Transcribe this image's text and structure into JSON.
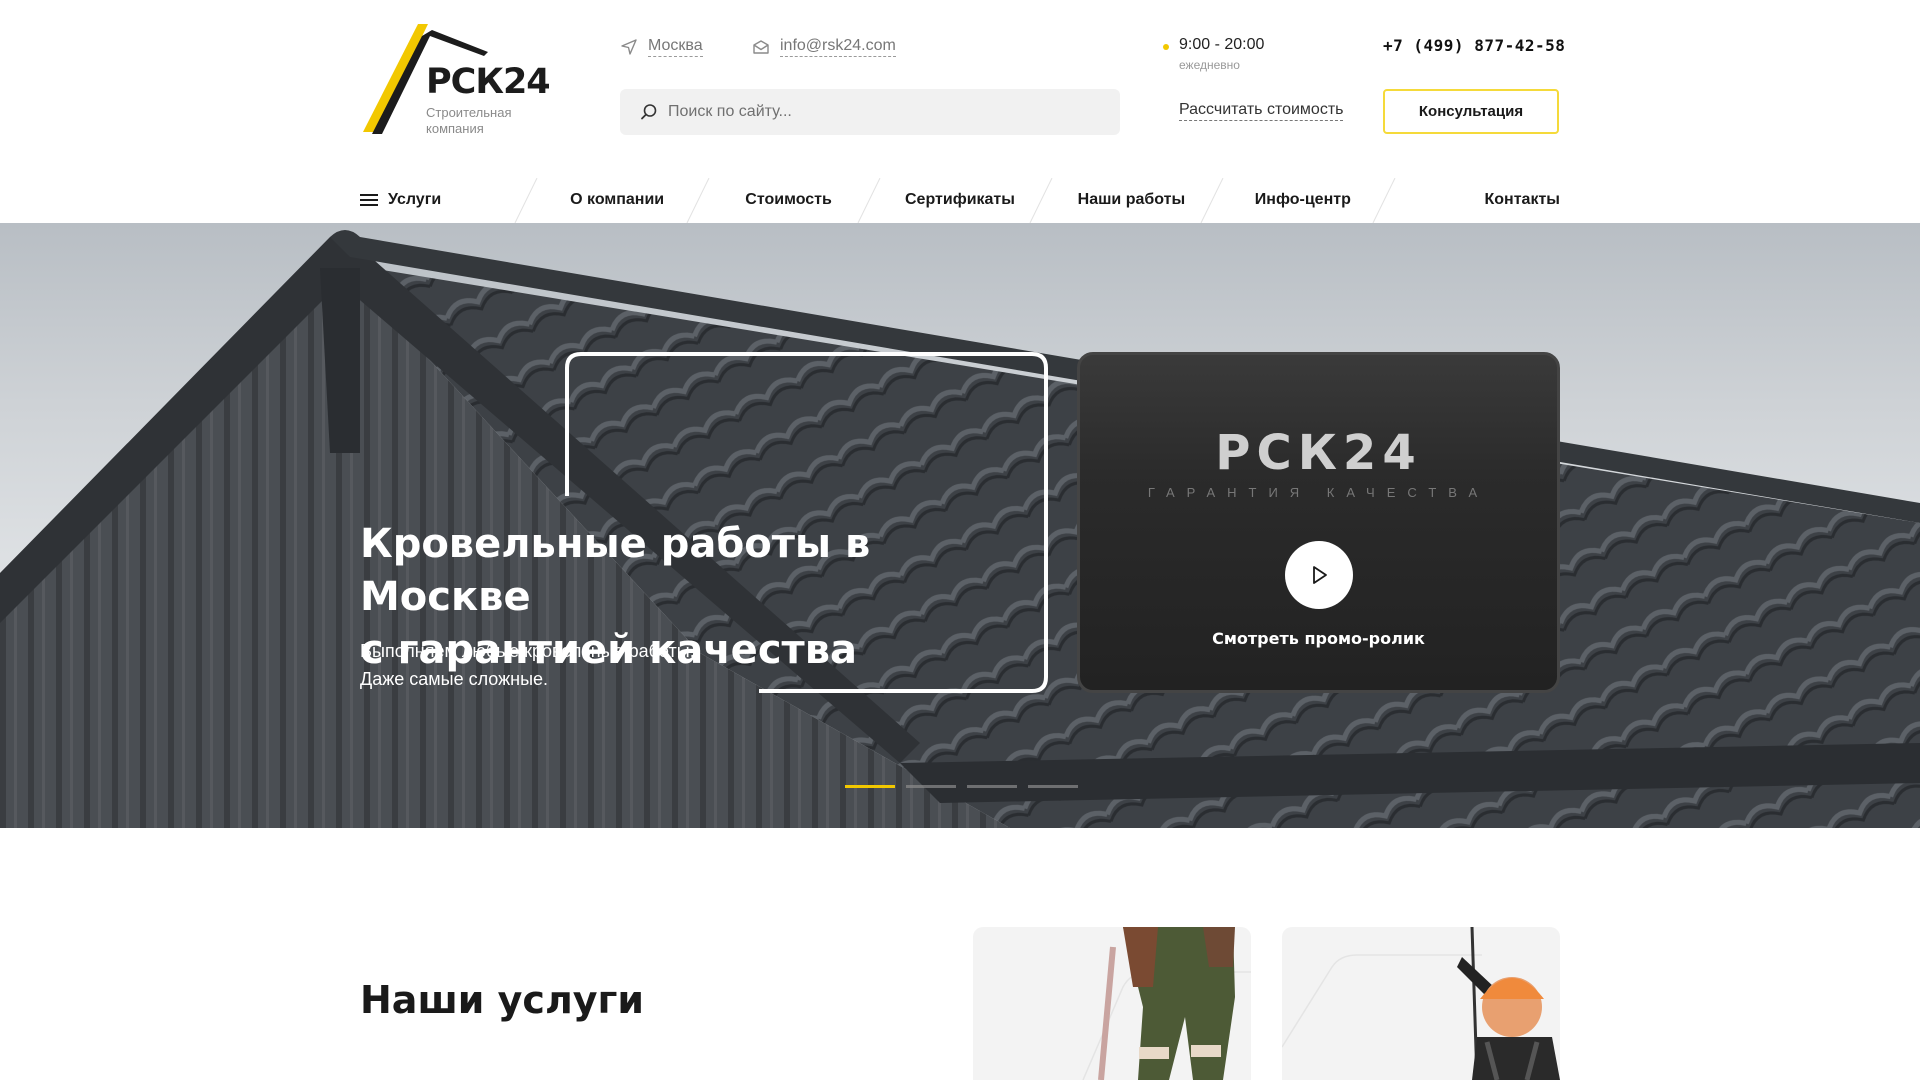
{
  "header": {
    "logo": {
      "name": "РСК24",
      "subtitle": "Строительная компания"
    },
    "city": "Москва",
    "email": "info@rsk24.com",
    "search_placeholder": "Поиск по сайту...",
    "hours": {
      "time": "9:00 - 20:00",
      "days": "ежедневно"
    },
    "phone": "+7 (499) 877-42-58",
    "calc_link": "Рассчитать стоимость",
    "consult_button": "Консультация"
  },
  "nav": {
    "items": [
      {
        "label": "Услуги"
      },
      {
        "label": "О компании"
      },
      {
        "label": "Стоимость"
      },
      {
        "label": "Сертификаты"
      },
      {
        "label": "Наши работы"
      },
      {
        "label": "Инфо-центр"
      },
      {
        "label": "Контакты"
      }
    ]
  },
  "hero": {
    "title_line1": "Кровельные работы в Москве",
    "title_line2": "с гарантией качества",
    "subtitle_line1": "Выполняем любые кровельные работы.",
    "subtitle_line2": "Даже самые сложные.",
    "video": {
      "logo": "РСК24",
      "tagline": "ГАРАНТИЯ КАЧЕСТВА",
      "label": "Смотреть промо-ролик"
    },
    "slides_total": 4,
    "active_slide": 1
  },
  "services": {
    "title": "Наши услуги"
  },
  "colors": {
    "accent": "#f2c800",
    "text": "#1a1a1a",
    "search_bg": "#f1f1f1"
  }
}
